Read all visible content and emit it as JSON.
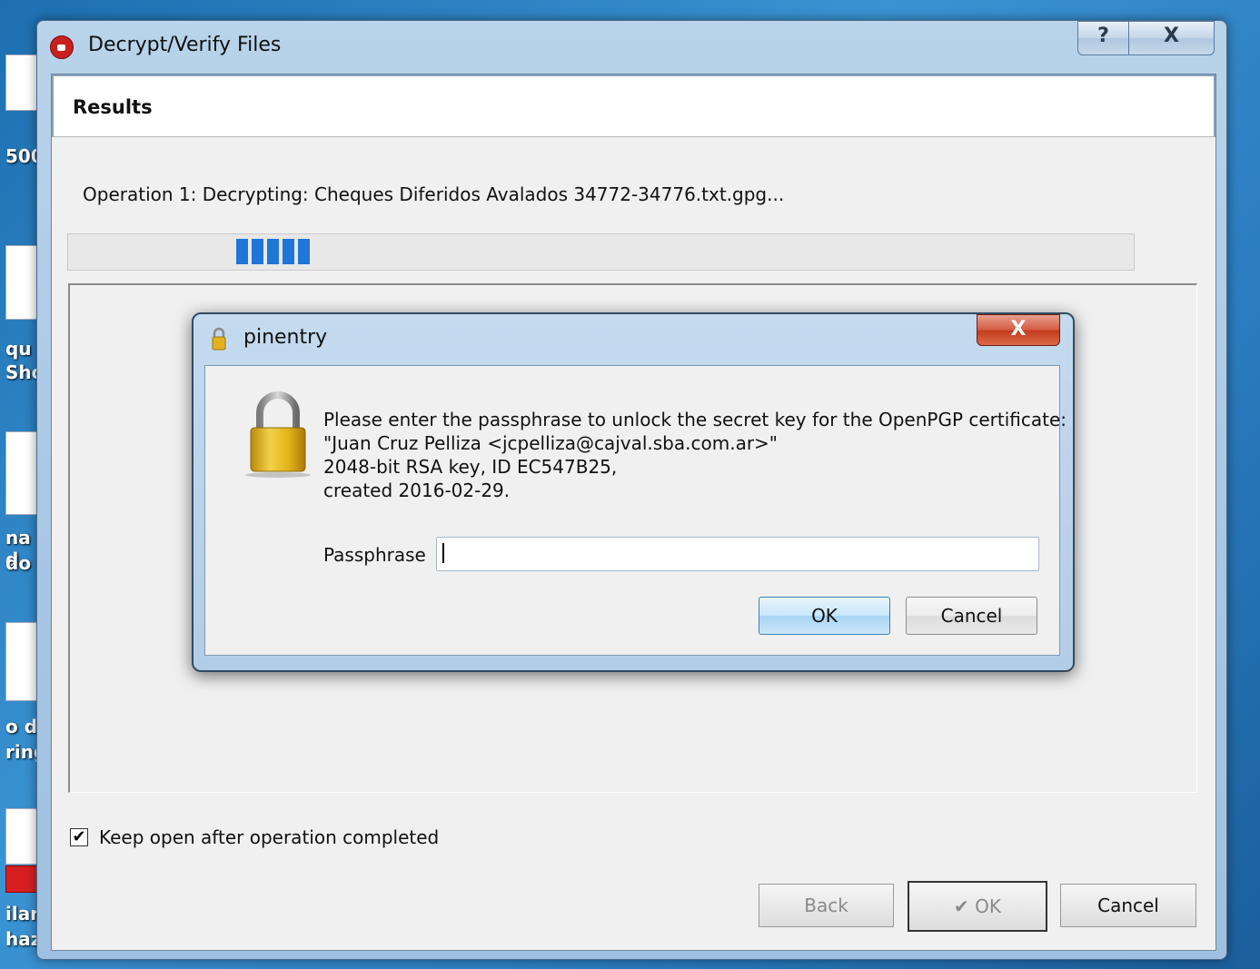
{
  "desktop": {
    "texts": [
      "500",
      "qu",
      "Sho",
      "na d",
      "do",
      "o d",
      "ring",
      "ilar",
      "haz"
    ]
  },
  "main_window": {
    "title": "Decrypt/Verify Files",
    "help_label": "?",
    "close_label": "X",
    "header_title": "Results",
    "operation_text": "Operation 1: Decrypting: Cheques Diferidos Avalados 34772-34776.txt.gpg...",
    "keep_open_label": "Keep open after operation completed",
    "keep_open_checked": true,
    "check_mark": "✔",
    "buttons": {
      "back": "Back",
      "ok": "✔ OK",
      "cancel": "Cancel"
    }
  },
  "pinentry": {
    "title": "pinentry",
    "close_label": "X",
    "message_lines": [
      "Please enter the passphrase to unlock the secret key for the OpenPGP certificate:",
      "\"Juan Cruz Pelliza <jcpelliza@cajval.sba.com.ar>\"",
      "2048-bit RSA key, ID EC547B25,",
      "created 2016-02-29."
    ],
    "passphrase_label": "Passphrase",
    "passphrase_value": "",
    "ok_label": "OK",
    "cancel_label": "Cancel"
  },
  "icons": {
    "app": "gpg4win-logo-icon",
    "lock": "padlock-icon"
  },
  "colors": {
    "progress": "#1f75d8",
    "title_bar": "#b9d3ea",
    "close_button": "#c23b1f"
  }
}
